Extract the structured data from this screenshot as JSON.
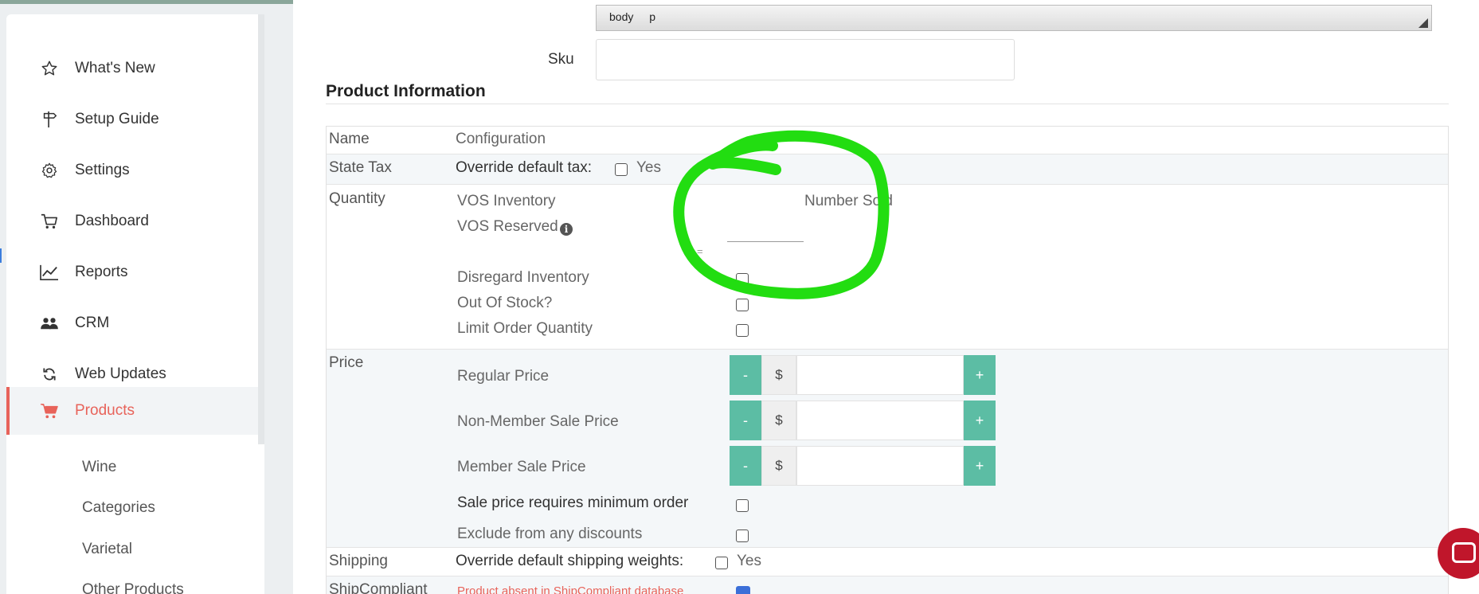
{
  "sidebar": {
    "items": [
      {
        "label": "What's New",
        "icon": "star-icon"
      },
      {
        "label": "Setup Guide",
        "icon": "signpost-icon"
      },
      {
        "label": "Settings",
        "icon": "gear-icon"
      },
      {
        "label": "Dashboard",
        "icon": "cart-icon"
      },
      {
        "label": "Reports",
        "icon": "chart-line-icon"
      },
      {
        "label": "CRM",
        "icon": "users-icon"
      },
      {
        "label": "Web Updates",
        "icon": "sync-icon"
      },
      {
        "label": "Products",
        "icon": "shopping-cart-icon",
        "active": true
      }
    ],
    "subitems": [
      "Wine",
      "Categories",
      "Varietal",
      "Other Products"
    ]
  },
  "editor": {
    "path_1": "body",
    "path_2": "p"
  },
  "sku": {
    "label": "Sku",
    "value": ""
  },
  "product_info": {
    "title": "Product Information",
    "col_name": "Name",
    "col_config": "Configuration",
    "state_tax": {
      "name": "State Tax",
      "label": "Override default tax:",
      "yes": "Yes"
    },
    "quantity": {
      "name": "Quantity",
      "vos_inventory": "VOS Inventory",
      "number_sold": "Number Sold",
      "vos_reserved": "VOS Reserved",
      "equals": "=",
      "disregard": "Disregard Inventory",
      "out_of_stock": "Out Of Stock?",
      "limit_qty": "Limit Order Quantity"
    },
    "price": {
      "name": "Price",
      "regular": "Regular Price",
      "non_member": "Non-Member Sale Price",
      "member": "Member Sale Price",
      "minus": "-",
      "plus": "+",
      "currency": "$",
      "min_order": "Sale price requires minimum order",
      "exclude": "Exclude from any discounts"
    },
    "shipping": {
      "name": "Shipping",
      "label": "Override default shipping weights:",
      "yes": "Yes"
    },
    "shipcompliant": {
      "name": "ShipCompliant",
      "note": "Product absent in ShipCompliant database"
    }
  },
  "colors": {
    "accent": "#e8635a",
    "stepper": "#5cbda4",
    "annotation": "#22dd11",
    "chat": "#c0162b"
  }
}
